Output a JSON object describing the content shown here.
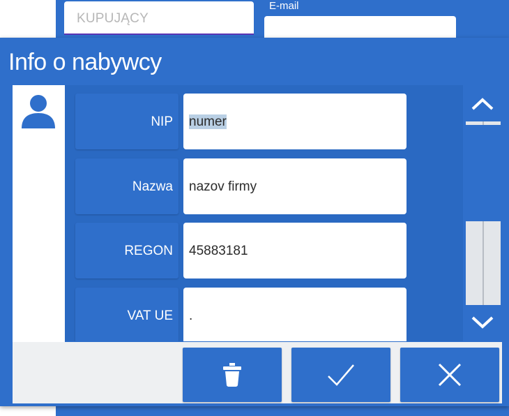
{
  "background_form": {
    "buyer_placeholder": "KUPUJĄCY",
    "email_label": "E-mail"
  },
  "dialog": {
    "title": "Info o nabywcy",
    "fields": [
      {
        "label": "NIP",
        "value": "numer",
        "selected": true
      },
      {
        "label": "Nazwa",
        "value": "nazov firmy"
      },
      {
        "label": "REGON",
        "value": "45883181"
      },
      {
        "label": "VAT UE",
        "value": "."
      }
    ],
    "scroll_position": 0.1,
    "buttons": [
      {
        "name": "delete",
        "icon": "trash-icon"
      },
      {
        "name": "confirm",
        "icon": "check-icon"
      },
      {
        "name": "cancel",
        "icon": "close-icon"
      }
    ]
  },
  "colors": {
    "accent": "#2f6fcb",
    "field_bg": "#ffffff",
    "selection": "#b9cfe4"
  }
}
